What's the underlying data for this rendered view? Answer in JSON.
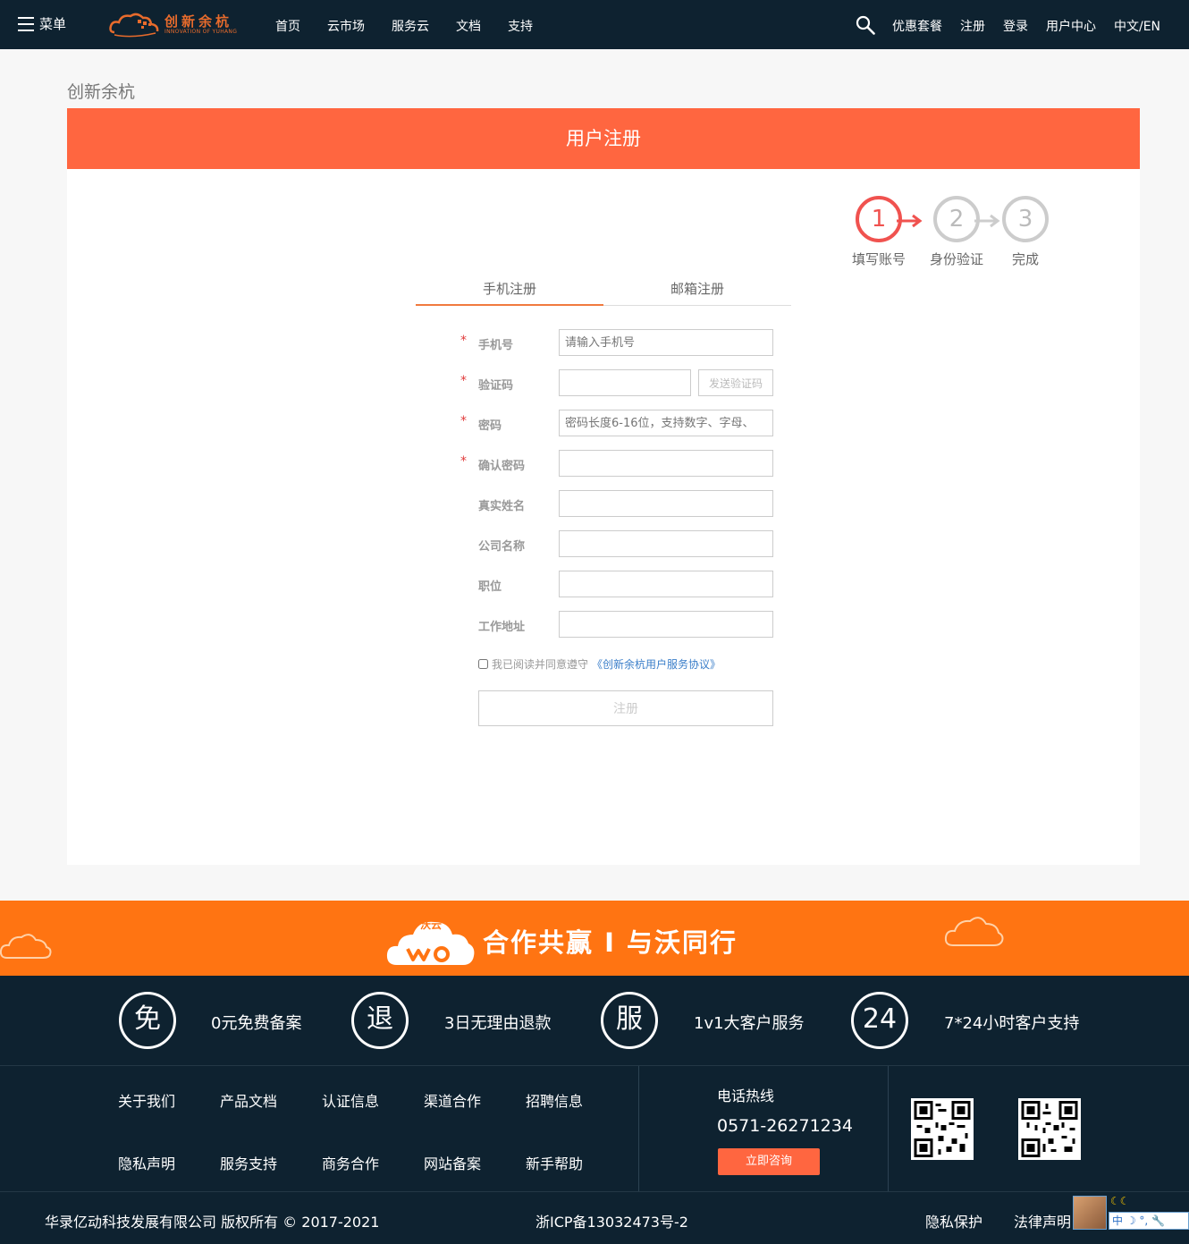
{
  "nav": {
    "menu_label": "菜单",
    "logo_cn": "创新余杭",
    "logo_en": "INNOVATION OF YUHANG",
    "links": [
      "首页",
      "云市场",
      "服务云",
      "文档",
      "支持"
    ],
    "right_links": [
      "优惠套餐",
      "注册",
      "登录",
      "用户中心",
      "中文/EN"
    ]
  },
  "breadcrumb": "创新余杭",
  "register": {
    "title": "用户注册",
    "steps": [
      {
        "num": "1",
        "label": "填写账号"
      },
      {
        "num": "2",
        "label": "身份验证"
      },
      {
        "num": "3",
        "label": "完成"
      }
    ],
    "tabs": [
      "手机注册",
      "邮箱注册"
    ],
    "fields": {
      "phone": {
        "label": "手机号",
        "placeholder": "请输入手机号"
      },
      "code": {
        "label": "验证码",
        "placeholder": "",
        "button": "发送验证码"
      },
      "password": {
        "label": "密码",
        "placeholder": "密码长度6-16位，支持数字、字母、"
      },
      "confirm": {
        "label": "确认密码",
        "placeholder": ""
      },
      "realname": {
        "label": "真实姓名",
        "placeholder": ""
      },
      "company": {
        "label": "公司名称",
        "placeholder": ""
      },
      "position": {
        "label": "职位",
        "placeholder": ""
      },
      "address": {
        "label": "工作地址",
        "placeholder": ""
      }
    },
    "agree_text": "我已阅读并同意遵守",
    "agree_link": "《创新余杭用户服务协议》",
    "submit": "注册"
  },
  "banner": {
    "logo_text": "沃云",
    "slogan": "合作共赢 I 与沃同行"
  },
  "features": [
    {
      "icon": "免",
      "text": "0元免费备案"
    },
    {
      "icon": "退",
      "text": "3日无理由退款"
    },
    {
      "icon": "服",
      "text": "1v1大客户服务"
    },
    {
      "icon": "24",
      "text": "7*24小时客户支持"
    }
  ],
  "footer_links": {
    "row1": [
      "关于我们",
      "产品文档",
      "认证信息",
      "渠道合作",
      "招聘信息"
    ],
    "row2": [
      "隐私声明",
      "服务支持",
      "商务合作",
      "网站备案",
      "新手帮助"
    ]
  },
  "hotline": {
    "title": "电话热线",
    "number": "0571-26271234",
    "button": "立即咨询"
  },
  "bottom": {
    "copyright": "华录亿动科技发展有限公司 版权所有 © 2017-2021",
    "icp": "浙ICP备13032473号-2",
    "privacy": "隐私保护",
    "legal": "法律声明"
  },
  "widget": {
    "bar_text": "中 ☽ °, 🔧",
    "moons": "☾☾"
  },
  "colors": {
    "nav_bg": "#0e2230",
    "accent": "#ff6640",
    "banner": "#ff7412",
    "step_active": "#f0524f"
  }
}
